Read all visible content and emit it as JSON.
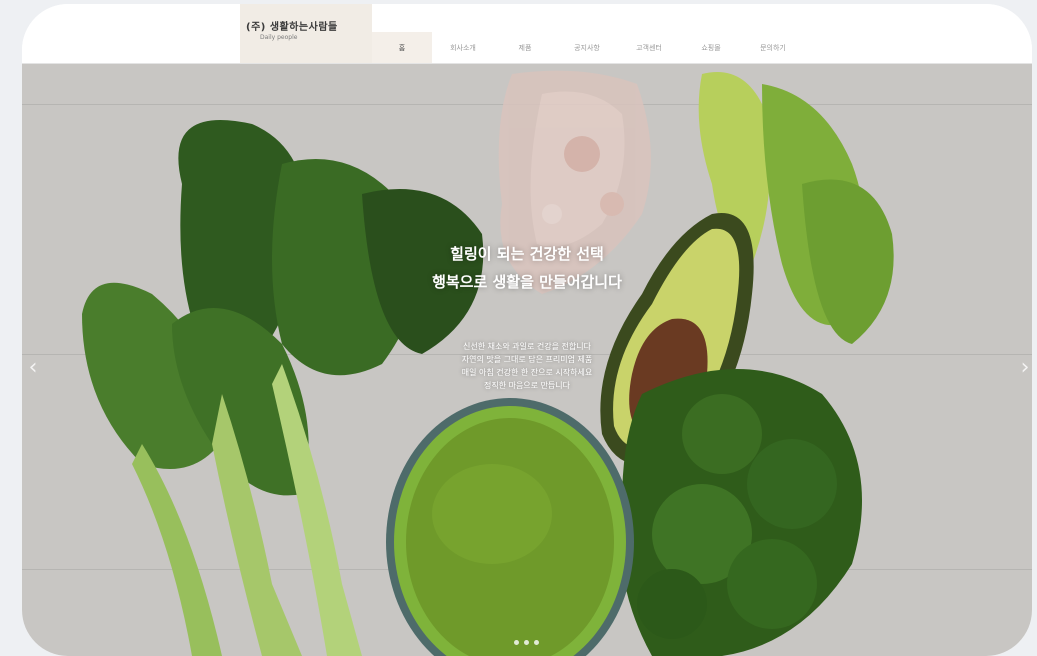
{
  "header": {
    "logo_text": "(주) 생활하는사람들",
    "logo_subtext": "Daily people",
    "nav": [
      "홈",
      "회사소개",
      "제품",
      "공지사항",
      "고객센터",
      "쇼핑몰",
      "문의하기"
    ]
  },
  "hero": {
    "title_lines": [
      "힐링이 되는 건강한 선택",
      "행복으로 생활을 만들어갑니다"
    ],
    "desc_lines": [
      "신선한 채소와 과일로 건강을 전합니다",
      "자연의 맛을 그대로 담은 프리미엄 제품",
      "매일 아침 건강한 한 잔으로 시작하세요",
      "정직한 마음으로 만듭니다"
    ],
    "slide_count": 3
  },
  "colors": {
    "logo_bg": "#f1ece5",
    "hero_bg": "#c8c6c3",
    "accent_green": "#6f9a2a"
  }
}
